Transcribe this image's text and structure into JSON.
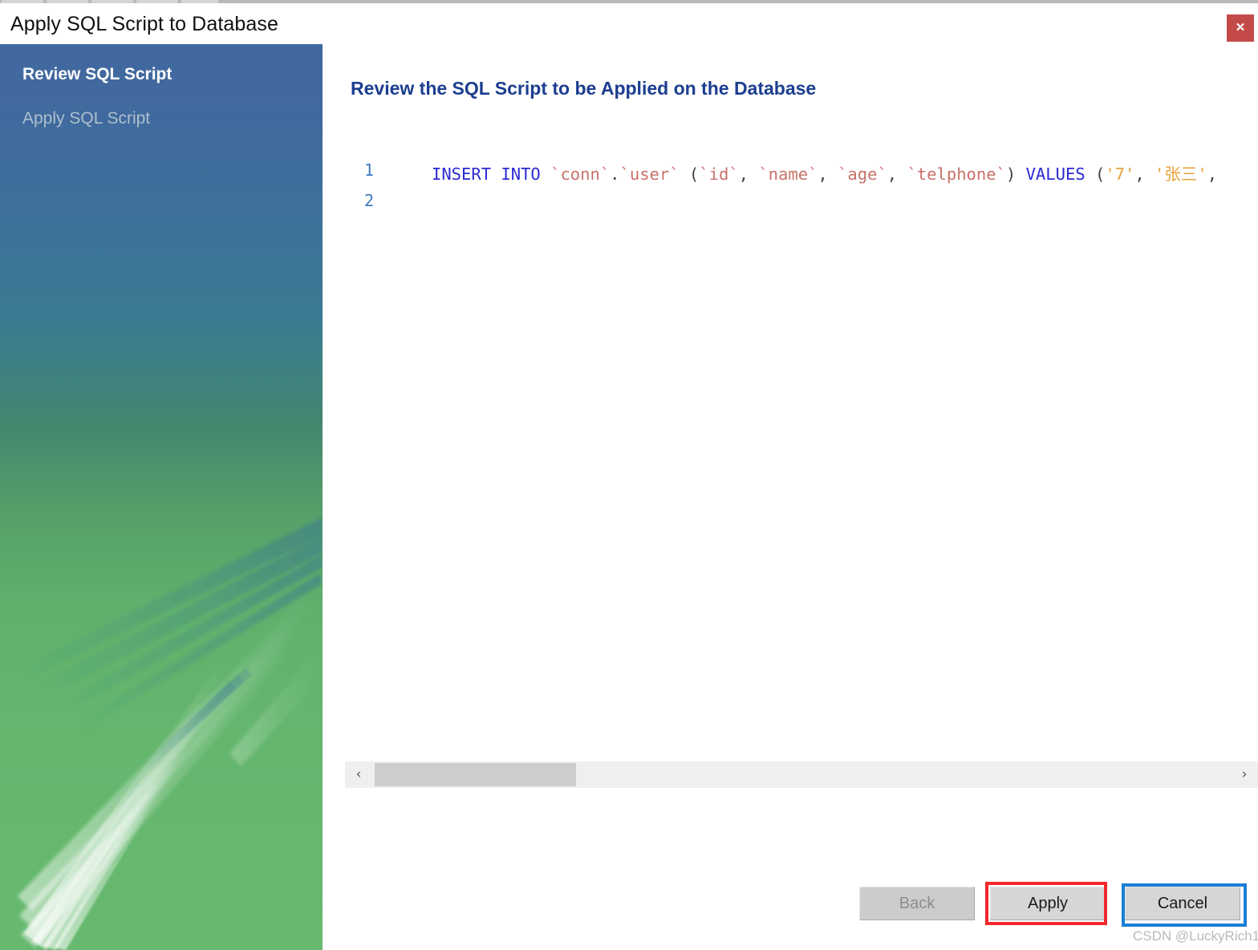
{
  "window": {
    "title": "Apply SQL Script to Database",
    "close_label": "✕",
    "close_icon": "close-icon"
  },
  "sidebar": {
    "items": [
      {
        "label": "Review SQL Script",
        "state": "active"
      },
      {
        "label": "Apply SQL Script",
        "state": "inactive"
      }
    ],
    "colors": {
      "top": "#41699f",
      "bottom": "#66b96e"
    }
  },
  "main": {
    "heading": "Review the SQL Script to be Applied on the Database",
    "heading_color": "#1b3e8f",
    "editor": {
      "lines": [
        {
          "number": "1",
          "tokens": [
            {
              "text": "INSERT INTO ",
              "type": "kw"
            },
            {
              "text": "`conn`",
              "type": "id"
            },
            {
              "text": ".",
              "type": "punc"
            },
            {
              "text": "`user`",
              "type": "id"
            },
            {
              "text": " (",
              "type": "punc"
            },
            {
              "text": "`id`",
              "type": "id"
            },
            {
              "text": ", ",
              "type": "punc"
            },
            {
              "text": "`name`",
              "type": "id"
            },
            {
              "text": ", ",
              "type": "punc"
            },
            {
              "text": "`age`",
              "type": "id"
            },
            {
              "text": ", ",
              "type": "punc"
            },
            {
              "text": "`telphone`",
              "type": "id"
            },
            {
              "text": ") ",
              "type": "punc"
            },
            {
              "text": "VALUES",
              "type": "kw"
            },
            {
              "text": " (",
              "type": "punc"
            },
            {
              "text": "'7'",
              "type": "str"
            },
            {
              "text": ", ",
              "type": "punc"
            },
            {
              "text": "'张三'",
              "type": "str"
            },
            {
              "text": ",",
              "type": "punc"
            }
          ]
        },
        {
          "number": "2",
          "tokens": []
        }
      ],
      "syntax_colors": {
        "keyword": "#2a2ad4",
        "identifier": "#c8726a",
        "string": "#e8a33d",
        "line_number": "#3b79bd"
      }
    },
    "scrollbar": {
      "left_arrow": "‹",
      "right_arrow": "›",
      "orientation": "horizontal"
    }
  },
  "footer": {
    "buttons": [
      {
        "label": "Back",
        "name": "back-button",
        "state": "disabled"
      },
      {
        "label": "Apply",
        "name": "apply-button",
        "state": "highlighted"
      },
      {
        "label": "Cancel",
        "name": "cancel-button",
        "state": "focused"
      }
    ],
    "highlight_color": "#f4282d",
    "focus_color": "#1a7fd4",
    "watermark": "CSDN @LuckyRich1"
  }
}
